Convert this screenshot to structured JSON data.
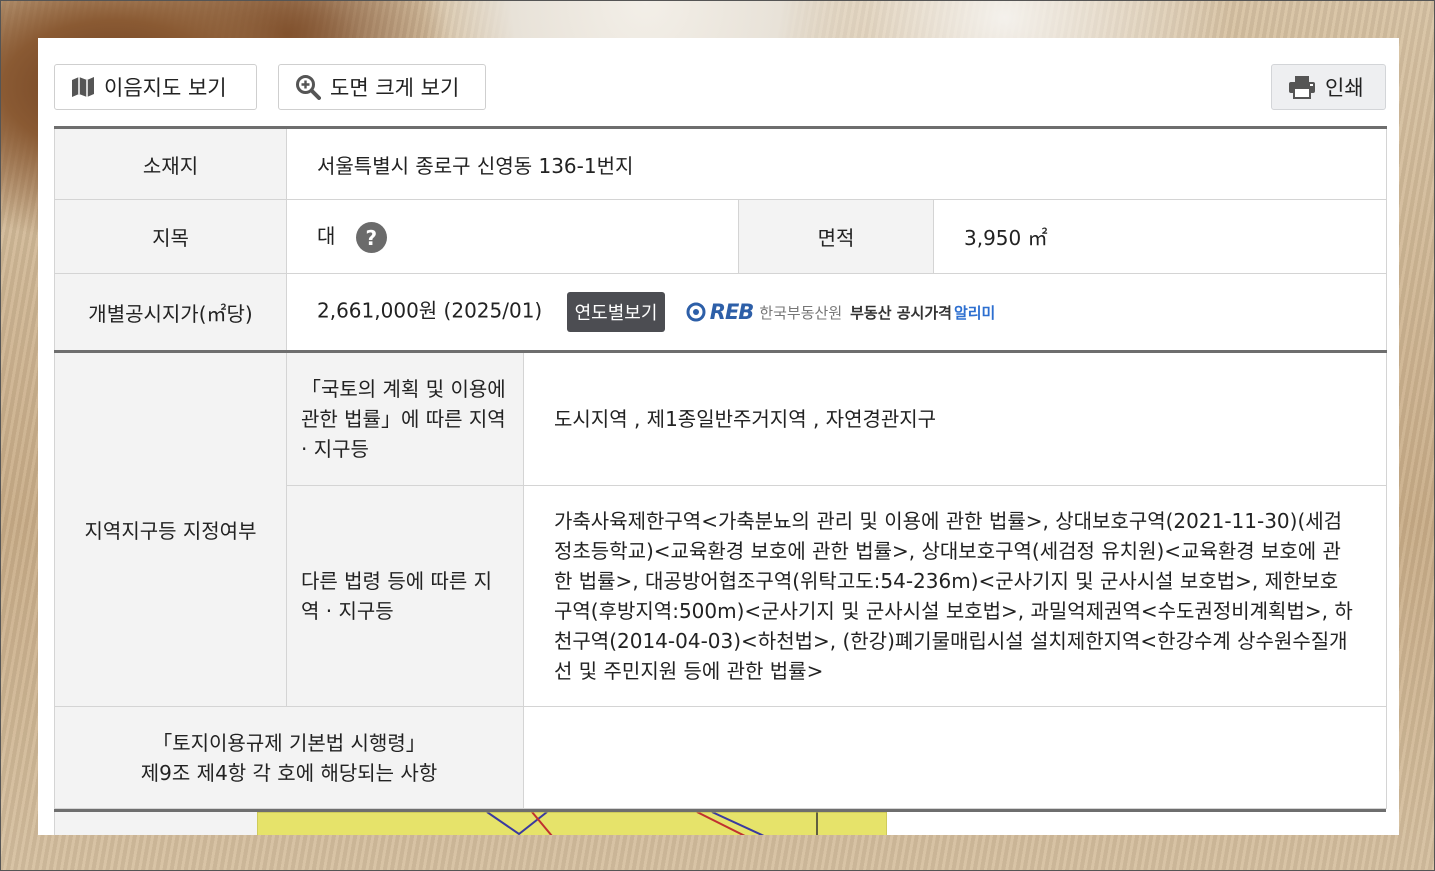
{
  "toolbar": {
    "map_label": "이음지도 보기",
    "zoom_label": "도면 크게 보기",
    "print_label": "인쇄"
  },
  "info": {
    "location_label": "소재지",
    "location_value": "서울특별시 종로구 신영동 136-1번지",
    "category_label": "지목",
    "category_value": "대",
    "help_mark": "?",
    "area_label": "면적",
    "area_value": "3,950 ㎡",
    "price_label": "개별공시지가(㎡당)",
    "price_value": "2,661,000원 (2025/01)",
    "yearly_button": "연도별보기",
    "reb_logo": "REB",
    "reb_org": "한국부동산원",
    "reb_service": "부동산 공시가격",
    "reb_service_highlight": "알리미"
  },
  "zoning": {
    "label": "지역지구등 지정여부",
    "law1_label": "「국토의 계획 및 이용에 관한 법률」에 따른 지역 · 지구등",
    "law1_value": "도시지역 , 제1종일반주거지역 , 자연경관지구",
    "law2_label": "다른 법령 등에 따른 지역 · 지구등",
    "law2_value": "가축사육제한구역<가축분뇨의 관리 및 이용에 관한 법률>, 상대보호구역(2021-11-30)(세검정초등학교)<교육환경 보호에 관한 법률>, 상대보호구역(세검정 유치원)<교육환경 보호에 관한 법률>, 대공방어협조구역(위탁고도:54-236m)<군사기지 및 군사시설 보호법>, 제한보호구역(후방지역:500m)<군사기지 및 군사시설 보호법>, 과밀억제권역<수도권정비계획법>, 하천구역(2014-04-03)<하천법>, (한강)폐기물매립시설 설치제한지역<한강수계 상수원수질개선 및 주민지원 등에 관한 법률>"
  },
  "regulation": {
    "label_line1": "「토지이용규제 기본법 시행령」",
    "label_line2": "제9조 제4항 각 호에 해당되는 사항",
    "value": ""
  },
  "colors": {
    "header_bg": "#f3f3f3",
    "border_dark": "#6e6e6e",
    "button_dark": "#4c4d52",
    "reb_blue": "#2d5fa8"
  }
}
